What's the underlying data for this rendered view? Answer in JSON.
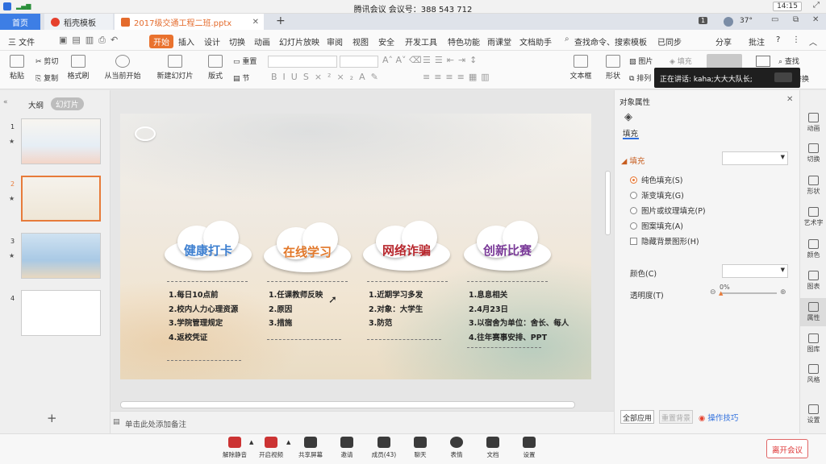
{
  "meeting": {
    "title": "腾讯会议 会议号：388 543 712",
    "time": "14:15",
    "end_button": "离开会议"
  },
  "tabs": [
    {
      "label": "首页"
    },
    {
      "label": "稻壳模板"
    },
    {
      "label": "2017级交通工程二班.pptx"
    }
  ],
  "system": {
    "badge": "1",
    "temperature": "37°"
  },
  "menu": {
    "file": "三 文件",
    "items": [
      "开始",
      "插入",
      "设计",
      "切换",
      "动画",
      "幻灯片放映",
      "审阅",
      "视图",
      "安全",
      "开发工具",
      "特色功能",
      "雨课堂",
      "文档助手"
    ],
    "search": "查找命令、搜索模板",
    "sync": "已同步",
    "share": "分享",
    "comment": "批注"
  },
  "ribbon": {
    "paste": "粘贴",
    "cut": "剪切",
    "copy": "复制",
    "format_painter": "格式刷",
    "from_start": "从当前开始",
    "new_slide": "新建幻灯片",
    "layout": "版式",
    "reset": "重置",
    "section": "节",
    "textbox": "文本框",
    "shape": "形状",
    "picture": "图片",
    "fill": "填充",
    "arrange": "排列",
    "find": "查找",
    "replace": "替换",
    "speaking": "正在讲话: kaha;大大大队长;"
  },
  "left_panel": {
    "outline_tab": "大纲",
    "slides_tab": "幻灯片",
    "slides": [
      "1",
      "2",
      "3",
      "4"
    ]
  },
  "notes_placeholder": "单击此处添加备注",
  "slide": {
    "clouds": [
      {
        "label": "健康打卡",
        "color": "#3d7fd0"
      },
      {
        "label": "在线学习",
        "color": "#e2782a"
      },
      {
        "label": "网络诈骗",
        "color": "#b8282e"
      },
      {
        "label": "创新比赛",
        "color": "#7a3a98"
      }
    ],
    "col1": [
      "1.每日10点前",
      "2.校内人力心理资源",
      "3.学院管理规定",
      "4.返校凭证"
    ],
    "col2": [
      "1.任课教师反映",
      "2.原因",
      "3.措施"
    ],
    "col3": [
      "1.近期学习多发",
      "2.对象：大学生",
      "3.防范"
    ],
    "col4": [
      "1.息息相关",
      "2.4月23日",
      "3.以宿舍为单位：舍长、每人",
      "4.往年赛事安排、PPT"
    ]
  },
  "properties": {
    "title": "对象属性",
    "tab": "填充",
    "section": "填充",
    "options": [
      "纯色填充(S)",
      "渐变填充(G)",
      "图片或纹理填充(P)",
      "图案填充(A)"
    ],
    "hide_bg": "隐藏背景图形(H)",
    "color_label": "颜色(C)",
    "transparency_label": "透明度(T)",
    "transparency_value": "0%",
    "apply_all": "全部应用",
    "reset_bg": "重置背景",
    "tips": "操作技巧"
  },
  "sidebar": [
    "动画",
    "切换",
    "形状",
    "艺术字",
    "颜色",
    "图表",
    "属性",
    "图库",
    "风格",
    "设置"
  ],
  "meeting_bar": [
    "解除静音",
    "开启视频",
    "共享屏幕",
    "邀请",
    "成员(43)",
    "聊天",
    "表情",
    "文档",
    "设置"
  ]
}
